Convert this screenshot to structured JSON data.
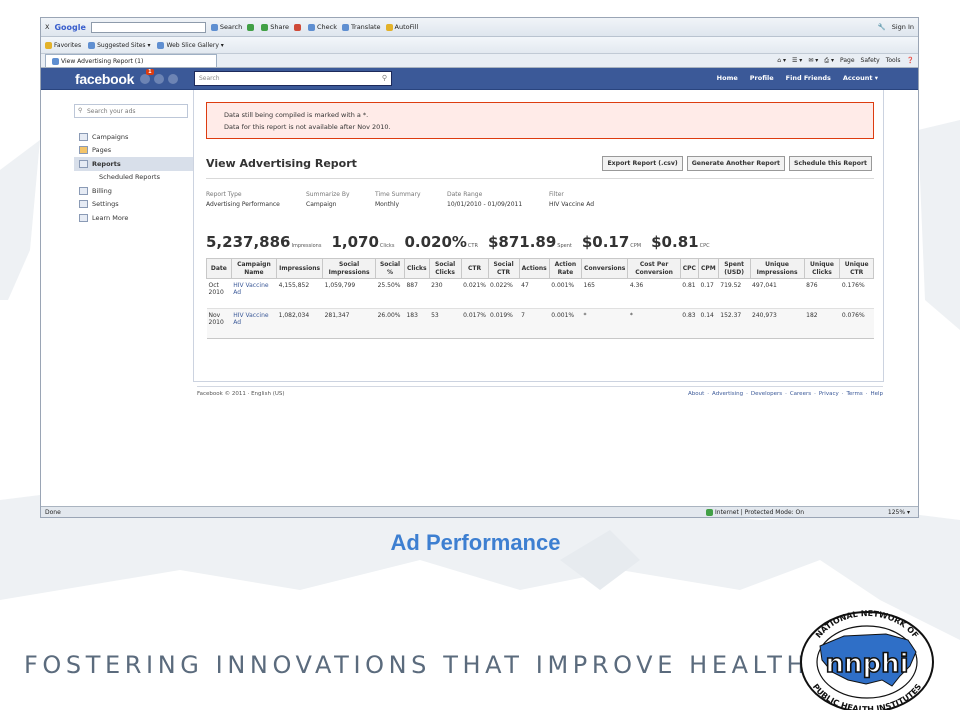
{
  "ie_toolbar": {
    "close": "X",
    "google": "Google",
    "items": [
      "Search",
      "Share",
      "Check",
      "Translate",
      "AutoFill"
    ],
    "sign_in": "Sign In"
  },
  "ie_favorites": {
    "favorites": "Favorites",
    "suggested": "Suggested Sites",
    "webslice": "Web Slice Gallery",
    "page": "Page",
    "safety": "Safety",
    "tools": "Tools"
  },
  "tab": {
    "title": "View Advertising Report (1)"
  },
  "facebook": {
    "logo": "facebook",
    "notification_count": "1",
    "search_placeholder": "Search",
    "nav": [
      "Home",
      "Profile",
      "Find Friends",
      "Account"
    ]
  },
  "sidebar": {
    "search_placeholder": "Search your ads",
    "items": [
      {
        "label": "Campaigns"
      },
      {
        "label": "Pages"
      },
      {
        "label": "Reports"
      },
      {
        "label": "Scheduled Reports"
      },
      {
        "label": "Billing"
      },
      {
        "label": "Settings"
      },
      {
        "label": "Learn More"
      }
    ]
  },
  "alert": {
    "line1": "Data still being compiled is marked with a *.",
    "line2": "Data for this report is not available after Nov 2010."
  },
  "report": {
    "title": "View Advertising Report",
    "buttons": [
      "Export Report (.csv)",
      "Generate Another Report",
      "Schedule this Report"
    ],
    "meta": [
      {
        "label": "Report Type",
        "value": "Advertising Performance"
      },
      {
        "label": "Summarize By",
        "value": "Campaign"
      },
      {
        "label": "Time Summary",
        "value": "Monthly"
      },
      {
        "label": "Date Range",
        "value": "10/01/2010 - 01/09/2011"
      },
      {
        "label": "Filter",
        "value": "HIV Vaccine Ad"
      }
    ],
    "stats": [
      {
        "value": "5,237,886",
        "label": "Impressions"
      },
      {
        "value": "1,070",
        "label": "Clicks"
      },
      {
        "value": "0.020%",
        "label": "CTR"
      },
      {
        "value": "$871.89",
        "label": "Spent"
      },
      {
        "value": "$0.17",
        "label": "CPM"
      },
      {
        "value": "$0.81",
        "label": "CPC"
      }
    ],
    "columns": [
      "Date",
      "Campaign Name",
      "Impressions",
      "Social Impressions",
      "Social %",
      "Clicks",
      "Social Clicks",
      "CTR",
      "Social CTR",
      "Actions",
      "Action Rate",
      "Conversions",
      "Cost Per Conversion",
      "CPC",
      "CPM",
      "Spent (USD)",
      "Unique Impressions",
      "Unique Clicks",
      "Unique CTR"
    ],
    "rows": [
      [
        "Oct 2010",
        "HIV Vaccine Ad",
        "4,155,852",
        "1,059,799",
        "25.50%",
        "887",
        "230",
        "0.021%",
        "0.022%",
        "47",
        "0.001%",
        "165",
        "4.36",
        "0.81",
        "0.17",
        "719.52",
        "497,041",
        "876",
        "0.176%"
      ],
      [
        "Nov 2010",
        "HIV Vaccine Ad",
        "1,082,034",
        "281,347",
        "26.00%",
        "183",
        "53",
        "0.017%",
        "0.019%",
        "7",
        "0.001%",
        "*",
        "*",
        "0.83",
        "0.14",
        "152.37",
        "240,973",
        "182",
        "0.076%"
      ]
    ]
  },
  "footer": {
    "left": "Facebook © 2011 · English (US)",
    "links": [
      "About",
      "Advertising",
      "Developers",
      "Careers",
      "Privacy",
      "Terms",
      "Help"
    ]
  },
  "statusbar": {
    "left": "Done",
    "zone": "Internet | Protected Mode: On",
    "zoom": "125%"
  },
  "slide": {
    "caption": "Ad Performance",
    "tagline": "FOSTERING INNOVATIONS THAT IMPROVE HEALTH",
    "logo_main": "nnphi",
    "logo_ring_top": "NATIONAL NETWORK OF",
    "logo_ring_bottom": "PUBLIC HEALTH INSTITUTES",
    "colors": {
      "caption": "#3d7fd1",
      "facebook_blue": "#3b5998",
      "alert_bg": "#ffebe8",
      "logo_blue": "#2f6fc7"
    }
  }
}
